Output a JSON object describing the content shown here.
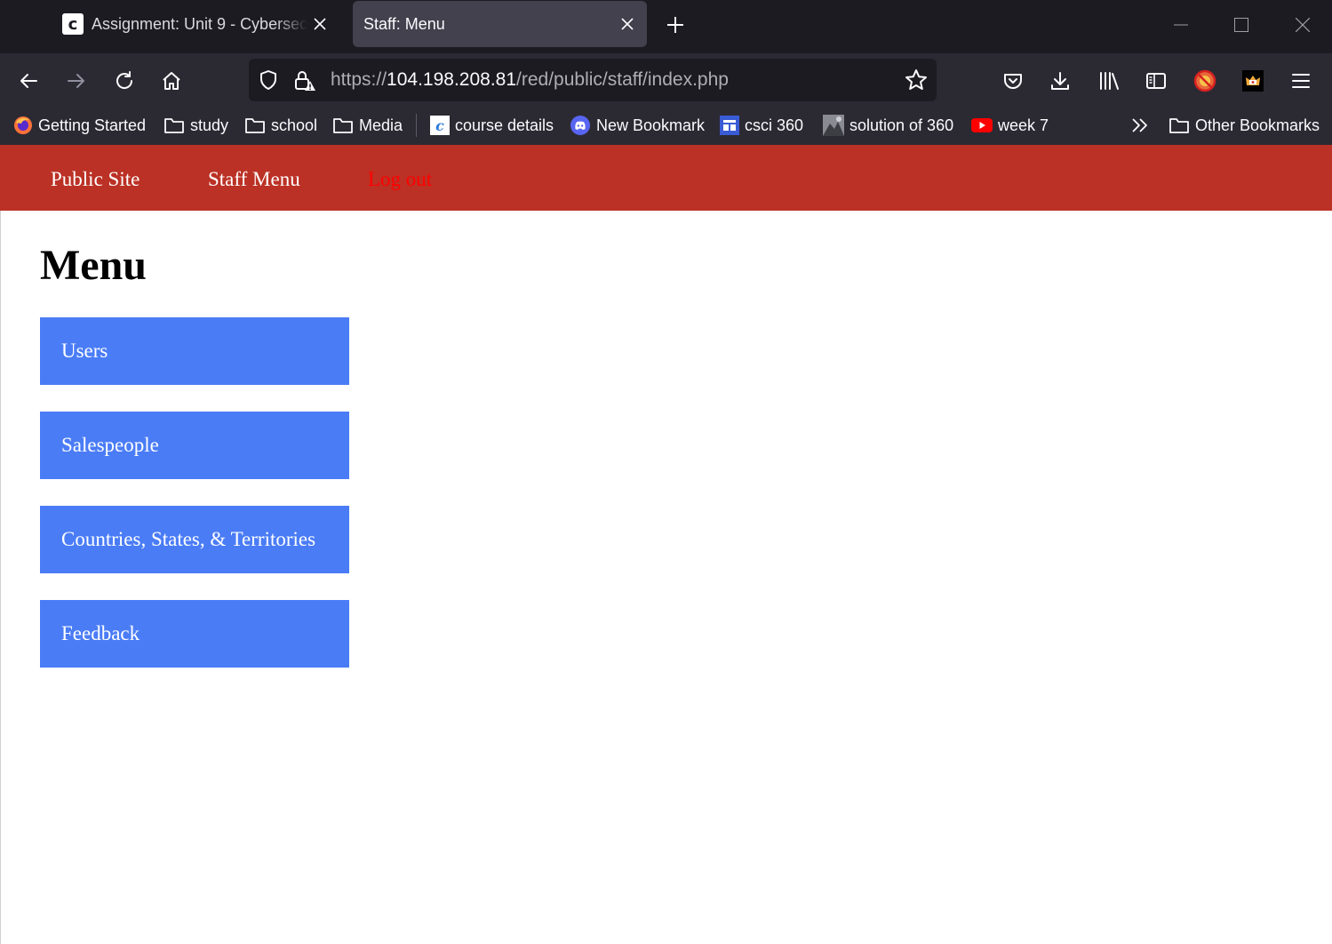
{
  "browser": {
    "tabs": [
      {
        "title": "Assignment: Unit 9 - Cybersecurity",
        "active": false,
        "favicon": "c"
      },
      {
        "title": "Staff: Menu",
        "active": true
      }
    ],
    "url": {
      "prefix": "https://",
      "host": "104.198.208.81",
      "path": "/red/public/staff/index.php"
    },
    "bookmarks": [
      {
        "label": "Getting Started",
        "icon": "firefox-icon"
      },
      {
        "label": "study",
        "icon": "folder-icon"
      },
      {
        "label": "school",
        "icon": "folder-icon"
      },
      {
        "label": "Media",
        "icon": "folder-icon"
      },
      {
        "label": "course details",
        "icon": "course-icon"
      },
      {
        "label": "New Bookmark",
        "icon": "discord-icon"
      },
      {
        "label": "csci 360",
        "icon": "site-icon"
      },
      {
        "label": "solution of 360",
        "icon": "image-icon"
      },
      {
        "label": "week 7",
        "icon": "youtube-icon"
      }
    ],
    "other_bookmarks": "Other Bookmarks"
  },
  "site": {
    "nav": {
      "public_site": "Public Site",
      "staff_menu": "Staff Menu",
      "logout": "Log out"
    },
    "colors": {
      "header": "#bb3125",
      "button": "#4a7cf6",
      "logout": "#ff0000"
    },
    "page_title": "Menu",
    "menu_items": [
      "Users",
      "Salespeople",
      "Countries, States, & Territories",
      "Feedback"
    ]
  }
}
